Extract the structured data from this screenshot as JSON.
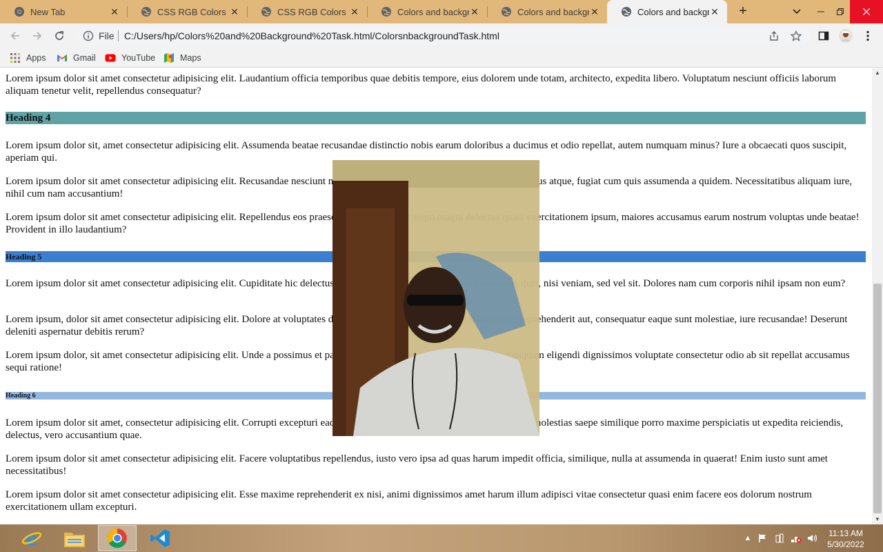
{
  "browser": {
    "tabs": [
      {
        "title": "New Tab",
        "active": false,
        "icon": "chrome-icon"
      },
      {
        "title": "CSS RGB Colors",
        "active": false,
        "icon": "globe-icon"
      },
      {
        "title": "CSS RGB Colors",
        "active": false,
        "icon": "globe-icon"
      },
      {
        "title": "Colors and backgrou",
        "active": false,
        "icon": "globe-icon"
      },
      {
        "title": "Colors and backgrou",
        "active": false,
        "icon": "globe-icon"
      },
      {
        "title": "Colors and backgrou",
        "active": true,
        "icon": "globe-icon"
      }
    ],
    "new_tab_label": "+",
    "address": {
      "scheme_label": "File",
      "url": "C:/Users/hp/Colors%20and%20Background%20Task.html/ColorsnbackgroundTask.html"
    },
    "bookmarks": [
      {
        "label": "Apps",
        "icon": "apps-grid-icon"
      },
      {
        "label": "Gmail",
        "icon": "gmail-icon"
      },
      {
        "label": "YouTube",
        "icon": "youtube-icon"
      },
      {
        "label": "Maps",
        "icon": "maps-icon"
      }
    ]
  },
  "page": {
    "paragraphs_top": [
      "Lorem ipsum dolor sit amet consectetur adipisicing elit. Laudantium officia temporibus quae debitis tempore, eius dolorem unde totam, architecto, expedita libero. Voluptatum nesciunt officiis laborum aliquam tenetur velit, repellendus consequatur?"
    ],
    "heading4": "Heading 4",
    "paragraphs_h4": [
      "Lorem ipsum dolor sit, amet consectetur adipisicing elit. Assumenda beatae recusandae distinctio nobis earum doloribus a ducimus et odio repellat, autem numquam minus? Iure a obcaecati quos suscipit, aperiam qui.",
      "Lorem ipsum dolor sit amet consectetur adipisicing elit. Recusandae nesciunt nostrum perspiciatis aut accusantium, sit repellendus atque, fugiat cum quis assumenda a quidem. Necessitatibus aliquam iure, nihil cum nam accusantium!",
      "Lorem ipsum dolor sit amet consectetur adipisicing elit. Repellendus eos praesentium eius tenetur sequi magni delectus quasi exercitationem ipsum, maiores accusamus earum nostrum voluptas unde beatae! Provident in illo laudantium?"
    ],
    "heading5": "Heading 5",
    "paragraphs_h5": [
      "Lorem ipsum dolor sit amet consectetur adipisicing elit. Cupiditate hic delectus asperiores quo, laudantium harum possimus quis, nisi veniam, sed vel sit. Dolores nam cum corporis nihil ipsam non eum?",
      "Lorem ipsum, dolor sit amet consectetur adipisicing elit. Dolore at voluptates doloribus eos perspiciatis in laboriosam, quae reprehenderit aut, consequatur eaque sunt molestiae, iure recusandae! Deserunt deleniti aspernatur debitis rerum?",
      "Lorem ipsum dolor, sit amet consectetur adipisicing elit. Unde a possimus et pariatur nihil libero animi provident facilis quisquam eligendi dignissimos voluptate consectetur odio ab sit repellat accusamus sequi ratione!"
    ],
    "heading6": "Heading 6",
    "paragraphs_h6": [
      "Lorem ipsum dolor sit amet, consectetur adipisicing elit. Corrupti excepturi eaque consequuntur ut? Molestiae quidem, quam a molestias saepe similique porro maxime perspiciatis ut expedita reiciendis, delectus, vero accusantium quae.",
      "Lorem ipsum dolor sit amet consectetur adipisicing elit. Facere voluptatibus repellendus, iusto vero ipsa ad quas harum impedit officia, similique, nulla at assumenda in quaerat! Enim iusto sunt amet necessitatibus!",
      "Lorem ipsum dolor sit amet consectetur adipisicing elit. Esse maxime reprehenderit ex nisi, animi dignissimos amet harum illum adipisci vitae consectetur quasi enim facere eos dolorum nostrum exercitationem ullam excepturi."
    ],
    "colors": {
      "heading4_bg": "#5fa3a7",
      "heading5_bg": "#3a7fd1",
      "heading6_bg": "#93b8e0"
    }
  },
  "taskbar": {
    "apps": [
      {
        "name": "internet-explorer-icon",
        "active": false
      },
      {
        "name": "file-explorer-icon",
        "active": false
      },
      {
        "name": "chrome-icon",
        "active": true
      },
      {
        "name": "vscode-icon",
        "active": false
      }
    ],
    "clock": {
      "time": "11:13 AM",
      "date": "5/30/2022"
    }
  }
}
